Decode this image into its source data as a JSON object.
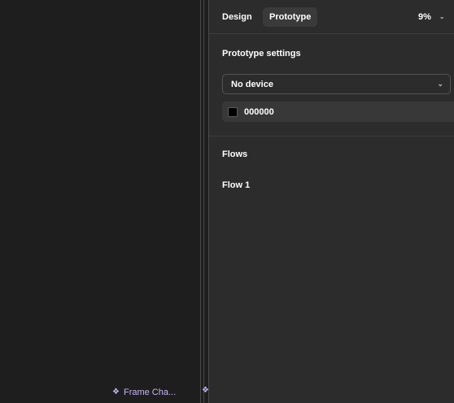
{
  "canvas": {
    "frame_chip_label": "Frame Cha...",
    "frame_chip_icon": "component-icon"
  },
  "panel": {
    "tabs": [
      {
        "label": "Design",
        "active": false
      },
      {
        "label": "Prototype",
        "active": true
      }
    ],
    "zoom": "9%",
    "prototype_settings": {
      "title": "Prototype settings",
      "device": "No device",
      "background_color": "000000",
      "swatch_color": "#000000"
    },
    "flows": {
      "title": "Flows",
      "items": [
        "Flow 1"
      ]
    }
  },
  "colors": {
    "canvas_bg": "#1e1e1e",
    "panel_bg": "#2c2c2c",
    "accent_purple": "#c7b5f5"
  }
}
